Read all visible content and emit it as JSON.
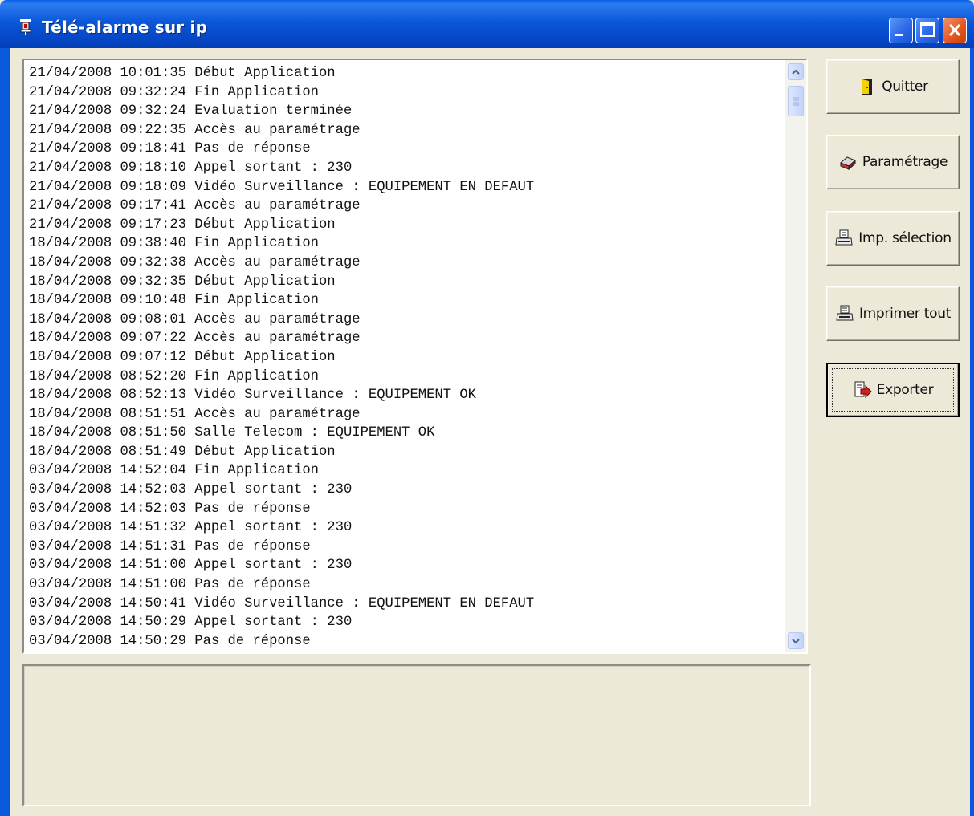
{
  "window": {
    "title": "Télé-alarme sur ip",
    "controls": [
      "minimize",
      "maximize",
      "close"
    ]
  },
  "log": {
    "lines": [
      "21/04/2008 10:01:35 Début Application",
      "21/04/2008 09:32:24 Fin Application",
      "21/04/2008 09:32:24 Evaluation terminée",
      "21/04/2008 09:22:35 Accès au paramétrage",
      "21/04/2008 09:18:41 Pas de réponse",
      "21/04/2008 09:18:10 Appel sortant : 230",
      "21/04/2008 09:18:09 Vidéo Surveillance : EQUIPEMENT EN DEFAUT",
      "21/04/2008 09:17:41 Accès au paramétrage",
      "21/04/2008 09:17:23 Début Application",
      "18/04/2008 09:38:40 Fin Application",
      "18/04/2008 09:32:38 Accès au paramétrage",
      "18/04/2008 09:32:35 Début Application",
      "18/04/2008 09:10:48 Fin Application",
      "18/04/2008 09:08:01 Accès au paramétrage",
      "18/04/2008 09:07:22 Accès au paramétrage",
      "18/04/2008 09:07:12 Début Application",
      "18/04/2008 08:52:20 Fin Application",
      "18/04/2008 08:52:13 Vidéo Surveillance : EQUIPEMENT OK",
      "18/04/2008 08:51:51 Accès au paramétrage",
      "18/04/2008 08:51:50 Salle Telecom : EQUIPEMENT OK",
      "18/04/2008 08:51:49 Début Application",
      "03/04/2008 14:52:04 Fin Application",
      "03/04/2008 14:52:03 Appel sortant : 230",
      "03/04/2008 14:52:03 Pas de réponse",
      "03/04/2008 14:51:32 Appel sortant : 230",
      "03/04/2008 14:51:31 Pas de réponse",
      "03/04/2008 14:51:00 Appel sortant : 230",
      "03/04/2008 14:51:00 Pas de réponse",
      "03/04/2008 14:50:41 Vidéo Surveillance : EQUIPEMENT EN DEFAUT",
      "03/04/2008 14:50:29 Appel sortant : 230",
      "03/04/2008 14:50:29 Pas de réponse"
    ]
  },
  "status_text": "",
  "buttons": {
    "quit": {
      "label": "Quitter",
      "icon": "door-exit-icon"
    },
    "settings": {
      "label": "Paramétrage",
      "icon": "settings-eraser-icon"
    },
    "print_selection": {
      "label": "Imp. sélection",
      "icon": "printer-icon"
    },
    "print_all": {
      "label": "Imprimer tout",
      "icon": "printer-icon"
    },
    "export": {
      "label": "Exporter",
      "icon": "export-document-icon"
    }
  },
  "colors": {
    "titlebar": "#0b57d9",
    "face": "#ece9d8",
    "close_button": "#e2541f"
  }
}
